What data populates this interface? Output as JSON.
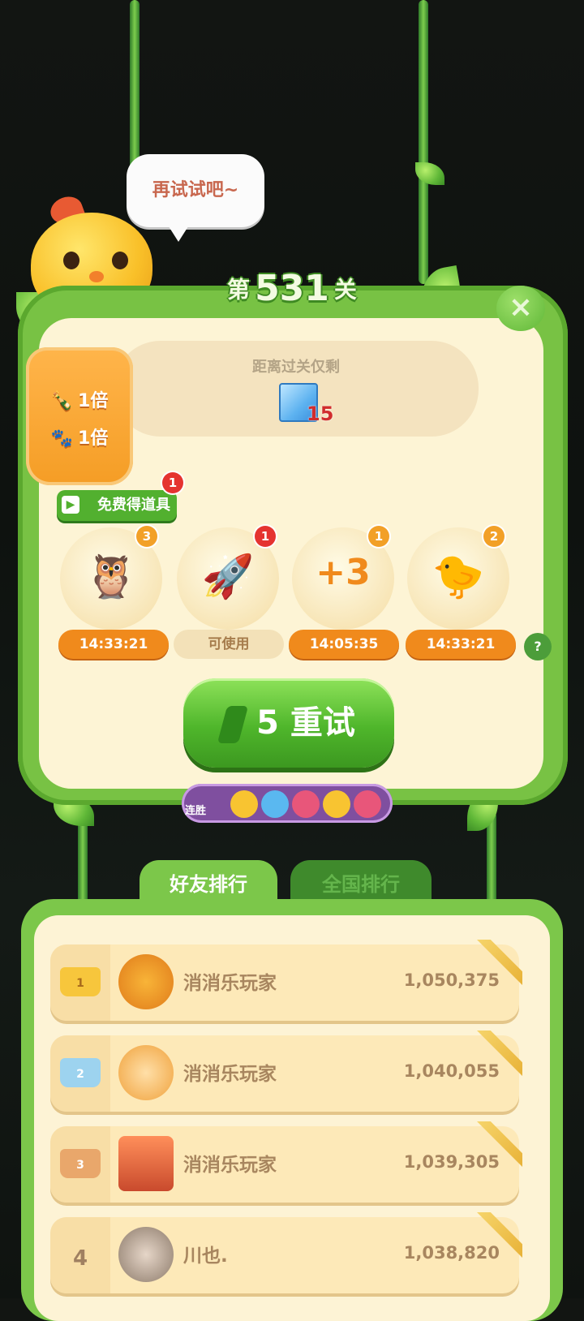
{
  "bubble_text": "再试试吧~",
  "level": {
    "prefix": "第",
    "number": "531",
    "suffix": "关"
  },
  "goal": {
    "label": "距离过关仅剩",
    "remaining": "15"
  },
  "multipliers": [
    {
      "icon": "bottle-icon",
      "text": "1倍"
    },
    {
      "icon": "cat-paw-icon",
      "text": "1倍"
    }
  ],
  "free_items": {
    "label": "免费得道具",
    "badge": "1"
  },
  "boosters": [
    {
      "name": "rainbow-owl-booster",
      "count": "3",
      "timer": "14:33:21",
      "glyph": "🦉"
    },
    {
      "name": "rocket-booster",
      "count": "1",
      "timer": "可使用",
      "glyph": "🚀"
    },
    {
      "name": "plus3-moves-booster",
      "count": "1",
      "timer": "14:05:35",
      "glyph": "+3"
    },
    {
      "name": "swap-animals-booster",
      "count": "2",
      "timer": "14:33:21",
      "glyph": "🐤"
    }
  ],
  "help": "?",
  "retry": {
    "cost": "5",
    "label": "重试"
  },
  "streak": {
    "label": "连胜"
  },
  "tabs": {
    "friends": "好友排行",
    "national": "全国排行"
  },
  "ranking": [
    {
      "rank": "1",
      "name": "消消乐玩家",
      "score": "1,050,375",
      "crown": "gold"
    },
    {
      "rank": "2",
      "name": "消消乐玩家",
      "score": "1,040,055",
      "crown": "silver"
    },
    {
      "rank": "3",
      "name": "消消乐玩家",
      "score": "1,039,305",
      "crown": "bronze"
    },
    {
      "rank": "4",
      "name": "川也.",
      "score": "1,038,820",
      "crown": ""
    }
  ],
  "close": "×"
}
